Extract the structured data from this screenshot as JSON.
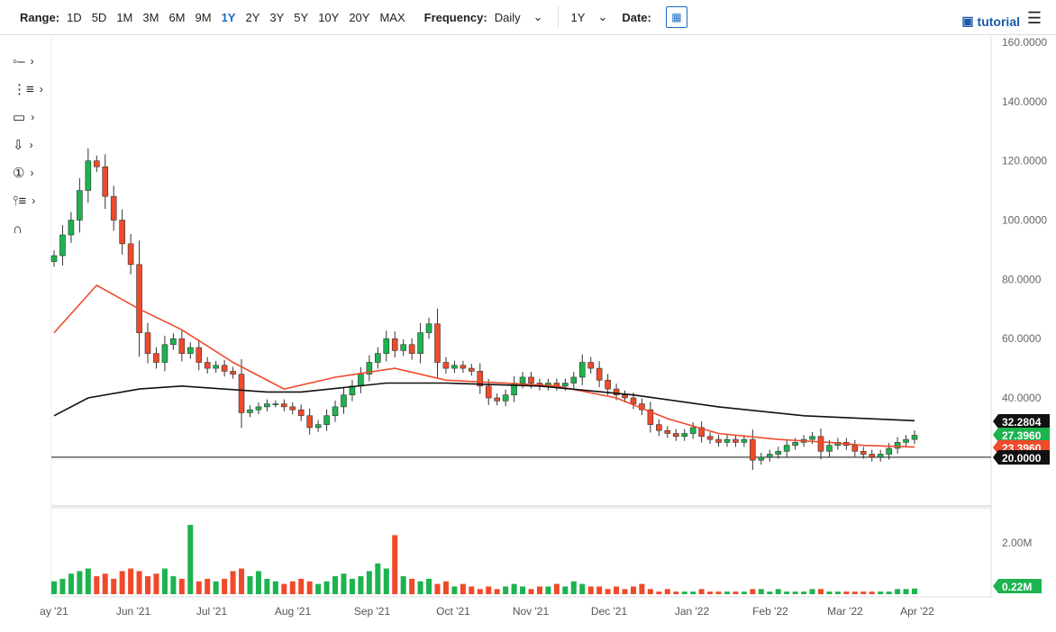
{
  "toolbar": {
    "range_label": "Range:",
    "ranges": [
      "1D",
      "5D",
      "1M",
      "3M",
      "6M",
      "9M",
      "1Y",
      "2Y",
      "3Y",
      "5Y",
      "10Y",
      "20Y",
      "MAX"
    ],
    "active_range": "1Y",
    "frequency_label": "Frequency:",
    "frequency_value": "Daily",
    "period_value": "1Y",
    "date_label": "Date:",
    "tutorial": "tutorial"
  },
  "tools": [
    "line-tool-icon",
    "fibonacci-tool-icon",
    "rectangle-tool-icon",
    "arrow-down-tool-icon",
    "annotation-number-icon",
    "measure-tool-icon",
    "magnet-icon"
  ],
  "colors": {
    "up": "#1db34f",
    "down": "#ef4a2b",
    "ma_fast": "#ef4a2b",
    "ma_slow": "#111111",
    "accent": "#1a6bc4"
  },
  "chart_data": {
    "type": "candlestick",
    "ylim": [
      0,
      160
    ],
    "y_ticks": [
      40,
      60,
      80,
      100,
      120,
      140,
      160
    ],
    "y_tick_labels": [
      "40.0000",
      "60.0000",
      "80.0000",
      "100.0000",
      "120.0000",
      "140.0000",
      "160.0000"
    ],
    "x_tick_labels": [
      "ay '21",
      "Jun '21",
      "Jul '21",
      "Aug '21",
      "Sep '21",
      "Oct '21",
      "Nov '21",
      "Dec '21",
      "Jan '22",
      "Feb '22",
      "Mar '22",
      "Apr '22"
    ],
    "closes": [
      88,
      95,
      100,
      110,
      120,
      118,
      108,
      100,
      92,
      85,
      62,
      55,
      52,
      58,
      60,
      55,
      57,
      52,
      50,
      51,
      49,
      48,
      35,
      36,
      37,
      38,
      38,
      37,
      36,
      34,
      30,
      31,
      34,
      37,
      41,
      44,
      48,
      52,
      55,
      60,
      56,
      58,
      55,
      62,
      65,
      52,
      50,
      51,
      50,
      49,
      44,
      40,
      39,
      41,
      45,
      47,
      45,
      44,
      45,
      44,
      45,
      47,
      52,
      50,
      46,
      43,
      41,
      40,
      38,
      36,
      31,
      29,
      28,
      27,
      28,
      30,
      27,
      26,
      25,
      26,
      25,
      26,
      19,
      20,
      21,
      22,
      24,
      25,
      26,
      27,
      22,
      24,
      25,
      24,
      22,
      21,
      20,
      21,
      23,
      25,
      26,
      27.4
    ],
    "volume_millions": [
      0.5,
      0.6,
      0.8,
      0.9,
      1.0,
      0.7,
      0.8,
      0.6,
      0.9,
      1.0,
      0.9,
      0.7,
      0.8,
      1.0,
      0.7,
      0.6,
      2.7,
      0.5,
      0.6,
      0.5,
      0.6,
      0.9,
      1.0,
      0.7,
      0.9,
      0.6,
      0.5,
      0.4,
      0.5,
      0.6,
      0.5,
      0.4,
      0.5,
      0.7,
      0.8,
      0.6,
      0.7,
      0.9,
      1.2,
      1.0,
      2.3,
      0.7,
      0.6,
      0.5,
      0.6,
      0.4,
      0.5,
      0.3,
      0.4,
      0.3,
      0.2,
      0.3,
      0.2,
      0.3,
      0.4,
      0.3,
      0.2,
      0.3,
      0.3,
      0.4,
      0.3,
      0.5,
      0.4,
      0.3,
      0.3,
      0.2,
      0.3,
      0.2,
      0.3,
      0.4,
      0.2,
      0.1,
      0.2,
      0.1,
      0.1,
      0.1,
      0.2,
      0.1,
      0.1,
      0.1,
      0.1,
      0.1,
      0.2,
      0.2,
      0.1,
      0.2,
      0.1,
      0.1,
      0.1,
      0.2,
      0.2,
      0.1,
      0.1,
      0.1,
      0.1,
      0.1,
      0.1,
      0.1,
      0.1,
      0.2,
      0.2,
      0.22
    ],
    "volume_tick": "2.00M",
    "ma_fast": [
      [
        0,
        62
      ],
      [
        5,
        78
      ],
      [
        10,
        70
      ],
      [
        15,
        63
      ],
      [
        21,
        52
      ],
      [
        27,
        43
      ],
      [
        33,
        47
      ],
      [
        40,
        50
      ],
      [
        46,
        46
      ],
      [
        53,
        45
      ],
      [
        59,
        44
      ],
      [
        66,
        40
      ],
      [
        72,
        33
      ],
      [
        78,
        28
      ],
      [
        85,
        26
      ],
      [
        91,
        25
      ],
      [
        95,
        24
      ],
      [
        101,
        23.4
      ]
    ],
    "ma_slow": [
      [
        0,
        34
      ],
      [
        4,
        40
      ],
      [
        10,
        43
      ],
      [
        15,
        44
      ],
      [
        25,
        42
      ],
      [
        29,
        42
      ],
      [
        39,
        45
      ],
      [
        46,
        45
      ],
      [
        57,
        44
      ],
      [
        68,
        41
      ],
      [
        78,
        37
      ],
      [
        88,
        34
      ],
      [
        101,
        32.3
      ]
    ],
    "support_level": 20,
    "price_tags": [
      {
        "label": "32.2804",
        "value": 32.28,
        "color": "#111111"
      },
      {
        "label": "27.3960",
        "value": 27.4,
        "color": "#1db34f"
      },
      {
        "label": "23.3960",
        "value": 23.4,
        "color": "#ef4a2b"
      },
      {
        "label": "20.0000",
        "value": 20,
        "color": "#111111"
      }
    ],
    "volume_tag": {
      "label": "0.22M",
      "color": "#1db34f"
    }
  }
}
